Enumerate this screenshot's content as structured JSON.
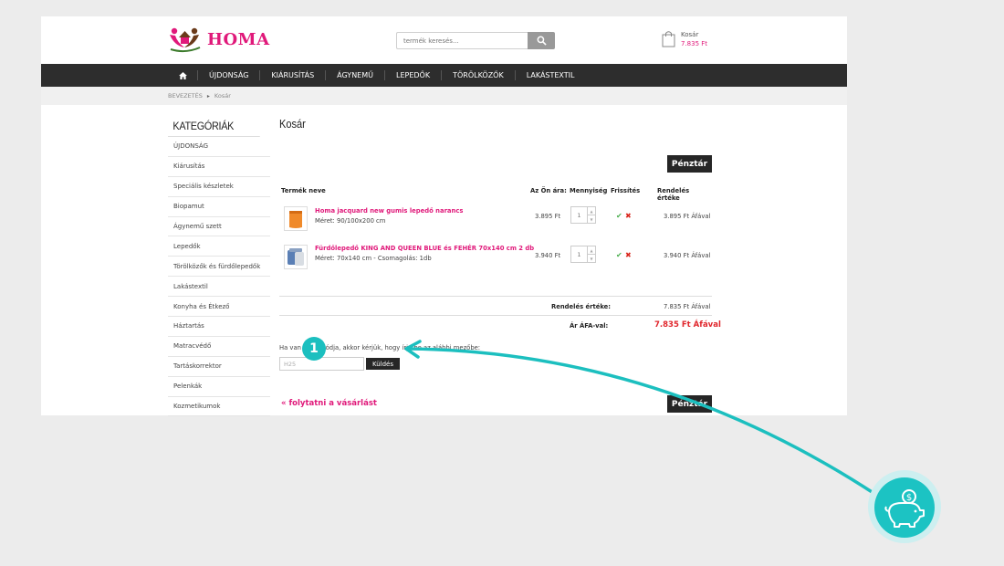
{
  "header": {
    "logo_text": "HOMA",
    "search_placeholder": "termék keresés...",
    "cart_label": "Kosár",
    "cart_total": "7.835 Ft"
  },
  "nav": {
    "items": [
      "ÚJDONSÁG",
      "KIÁRUSÍTÁS",
      "ÁGYNEMŰ",
      "LEPEDŐK",
      "TÖRÖLKÖZŐK",
      "LAKÁSTEXTIL"
    ]
  },
  "breadcrumb": {
    "home": "BEVEZETÉS",
    "separator": "▸",
    "current": "Kosár"
  },
  "sidebar": {
    "title": "KATEGÓRIÁK",
    "items": [
      "ÚJDONSÁG",
      "Kiárusítás",
      "Speciális készletek",
      "Biopamut",
      "Ágynemű szett",
      "Lepedők",
      "Törölközők és fürdőlepedők",
      "Lakástextil",
      "Konyha és Étkező",
      "Háztartás",
      "Matracvédő",
      "Tartáskorrektor",
      "Pelenkák",
      "Kozmetikumok"
    ]
  },
  "main": {
    "title": "Kosár",
    "checkout_label": "Pénztár",
    "columns": {
      "product": "Termék neve",
      "price": "Az Ön ára:",
      "qty": "Mennyiség",
      "update": "Frissítés",
      "total": "Rendelés értéke"
    },
    "rows": [
      {
        "name": "Homa jacquard new gumis lepedő narancs",
        "meta": "Méret: 90/100x200 cm",
        "price": "3.895 Ft",
        "qty": "1",
        "total": "3.895 Ft Áfával"
      },
      {
        "name": "Fürdőlepedő KING AND QUEEN BLUE és FEHÉR 70x140 cm 2 db",
        "meta": "Méret: 70x140 cm - Csomagolás: 1db",
        "price": "3.940 Ft",
        "qty": "1",
        "total": "3.940 Ft Áfával"
      }
    ],
    "order_value_label": "Rendelés értéke:",
    "order_value": "7.835 Ft Áfával",
    "vat_label": "Ár ÁFA-val:",
    "vat_value": "7.835 Ft Áfával",
    "coupon_text": "Ha van kuponkódja, akkor kérjük, hogy írja be az alábbi mezőbe:",
    "coupon_value": "H25",
    "coupon_button": "Küldés",
    "continue_label": "« folytatni a vásárlást"
  },
  "annotation": {
    "step_number": "1",
    "accent": "#1cbfbf"
  }
}
